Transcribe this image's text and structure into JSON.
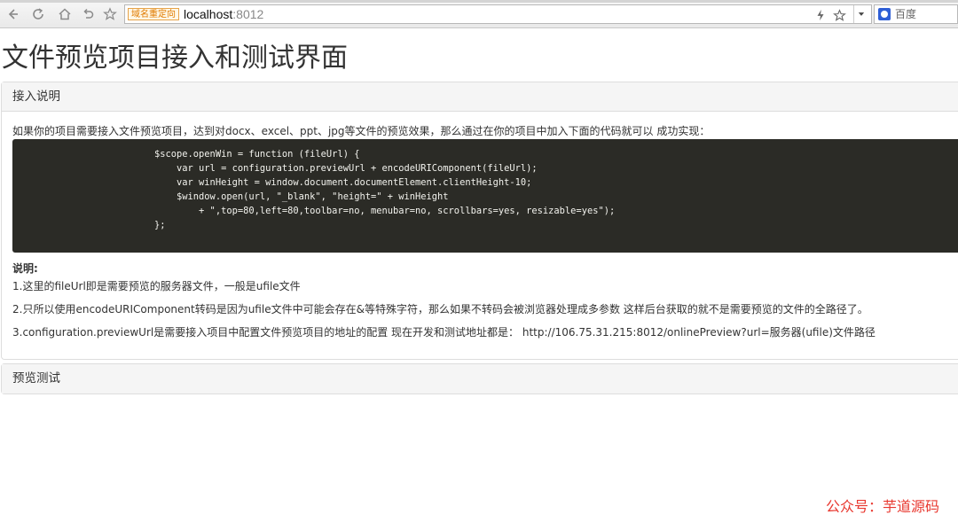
{
  "browser": {
    "redirect_badge": "域名重定向",
    "url_host": "localhost",
    "url_port": ":8012",
    "search_placeholder": "百度"
  },
  "page": {
    "title": "文件预览项目接入和测试界面"
  },
  "integration_panel": {
    "heading": "接入说明",
    "intro": "如果你的项目需要接入文件预览项目，达到对docx、excel、ppt、jpg等文件的预览效果，那么通过在你的项目中加入下面的代码就可以 成功实现：",
    "code_lines": [
      "$scope.openWin = function (fileUrl) {",
      "    var url = configuration.previewUrl + encodeURIComponent(fileUrl);",
      "    var winHeight = window.document.documentElement.clientHeight-10;",
      "    $window.open(url, \"_blank\", \"height=\" + winHeight",
      "        + \",top=80,left=80,toolbar=no, menubar=no, scrollbars=yes, resizable=yes\");",
      "};"
    ],
    "note_title": "说明:",
    "notes": [
      "1.这里的fileUrl即是需要预览的服务器文件，一般是ufile文件",
      "2.只所以使用encodeURIComponent转码是因为ufile文件中可能会存在&等特殊字符，那么如果不转码会被浏览器处理成多参数 这样后台获取的就不是需要预览的文件的全路径了。",
      "3.configuration.previewUrl是需要接入项目中配置文件预览项目的地址的配置 现在开发和测试地址都是： http://106.75.31.215:8012/onlinePreview?url=服务器(ufile)文件路径"
    ]
  },
  "test_panel": {
    "heading": "预览测试"
  },
  "watermark": "公众号：芋道源码"
}
